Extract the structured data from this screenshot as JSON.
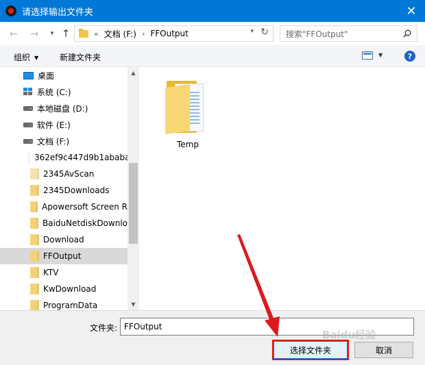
{
  "window": {
    "title": "请选择输出文件夹",
    "close_glyph": "✕"
  },
  "address_bar": {
    "overflow": "«",
    "segments": [
      "文档 (F:)",
      "FFOutput"
    ],
    "separator": "›"
  },
  "search": {
    "placeholder": "搜索\"FFOutput\""
  },
  "command_bar": {
    "organize_label": "组织",
    "new_folder_label": "新建文件夹",
    "help_glyph": "?"
  },
  "nav_tree": {
    "items": [
      {
        "label": "桌面",
        "icon": "desktop-icon"
      },
      {
        "label": "系统 (C:)",
        "icon": "system-drive-icon"
      },
      {
        "label": "本地磁盘 (D:)",
        "icon": "drive-icon"
      },
      {
        "label": "软件 (E:)",
        "icon": "drive-icon"
      },
      {
        "label": "文档 (F:)",
        "icon": "drive-icon"
      },
      {
        "label": "362ef9c447d9b1ababa",
        "icon": "folder-icon"
      },
      {
        "label": "2345AvScan",
        "icon": "folder-icon"
      },
      {
        "label": "2345Downloads",
        "icon": "folder-icon"
      },
      {
        "label": "Apowersoft Screen R",
        "icon": "folder-icon"
      },
      {
        "label": "BaiduNetdiskDownlo",
        "icon": "folder-icon"
      },
      {
        "label": "Download",
        "icon": "folder-icon"
      },
      {
        "label": "FFOutput",
        "icon": "folder-icon",
        "selected": true
      },
      {
        "label": "KTV",
        "icon": "folder-icon"
      },
      {
        "label": "KwDownload",
        "icon": "folder-icon"
      },
      {
        "label": "ProgramData",
        "icon": "folder-icon"
      }
    ]
  },
  "content": {
    "folders": [
      {
        "label": "Temp",
        "icon": "folder-with-documents-icon"
      }
    ]
  },
  "bottom": {
    "folder_label": "文件夹:",
    "folder_value": "FFOutput",
    "select_button": "选择文件夹",
    "cancel_button": "取消"
  },
  "watermark": "Baidu经验",
  "colors": {
    "titlebar": "#0078d7",
    "annotation": "#e0181e",
    "selection": "#d9d9d9"
  }
}
